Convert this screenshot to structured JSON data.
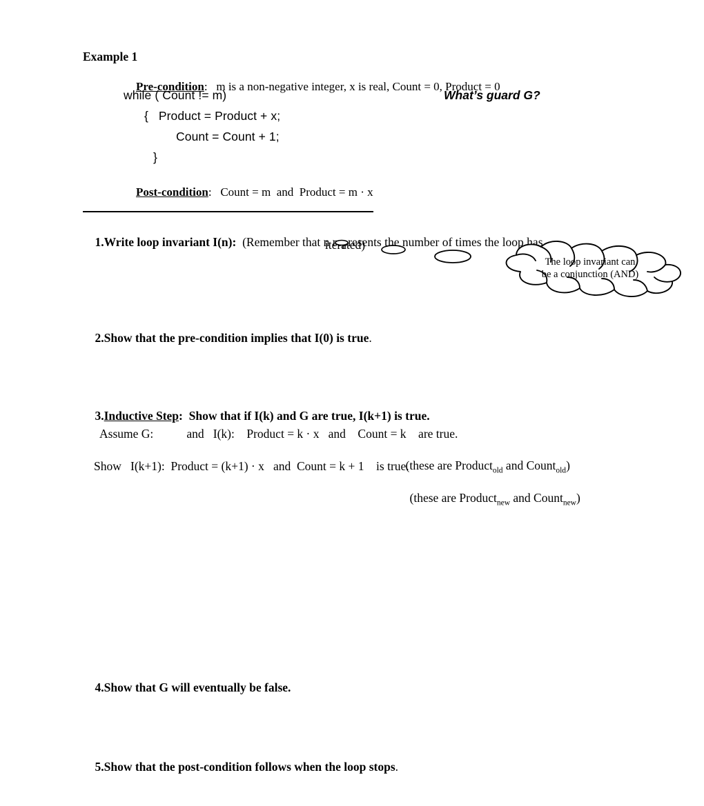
{
  "document": {
    "example_title": "Example 1",
    "precondition": {
      "label": "Pre-condition",
      "colon": ":",
      "text": "   m is a non-negative integer, x is real, Count = 0, Product = 0"
    },
    "code": {
      "while": "while ( Count != m)",
      "open_brace_stmt": "{   Product = Product + x;",
      "count_stmt": "Count = Count + 1;",
      "close_brace": "}"
    },
    "guard_question": "What’s guard G?",
    "postcondition": {
      "label": "Post-condition",
      "colon": ":",
      "text": "   Count = m  and  Product = m · x"
    },
    "items": [
      {
        "number": "1.",
        "head": "Write loop invariant I(n):",
        "tail": "  (Remember that n represents the number of times the loop has",
        "continuation": "iterated)"
      },
      {
        "number": "2.",
        "head": "Show that the pre-condition implies that I(0) is true",
        "tail": "."
      },
      {
        "number": "3.",
        "head_underlined": "Inductive Step",
        "head": ":  Show that if I(k) and G are true, I(k+1) is true.",
        "tail": ""
      },
      {
        "number": "4.",
        "head": "Show that G will eventually be false.",
        "tail": ""
      },
      {
        "number": "5.",
        "head": "Show that the post-condition follows when the loop stops",
        "tail": "."
      }
    ],
    "inductive_proof": {
      "assume_line": "Assume G:           and   I(k):    Product = k · x   and    Count = k    are true.",
      "old_note_prefix": "(these are Product",
      "old_sub": "old",
      "old_note_middle": " and Count",
      "old_note_suffix": ")",
      "show_line": "Show   I(k+1):  Product = (k+1) · x   and  Count = k + 1    is true.",
      "new_note_prefix": "(these are Product",
      "new_sub": "new",
      "new_note_middle": " and Count",
      "new_note_suffix": ")"
    },
    "cloud_callout": {
      "text": "The loop invariant can\nbe a conjunction (AND)"
    },
    "colors": {
      "ink": "#000000",
      "paper": "#ffffff"
    }
  }
}
